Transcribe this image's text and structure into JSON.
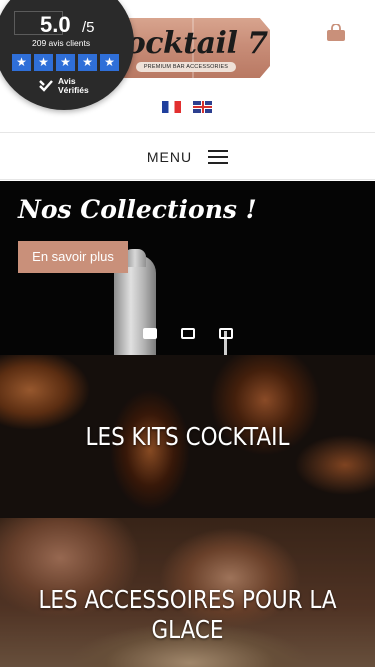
{
  "rating": {
    "score": "5.0",
    "max": "/5",
    "count": "209 avis clients",
    "stars": [
      "★",
      "★",
      "★",
      "★",
      "★"
    ],
    "brand_line1": "Avis",
    "brand_line2": "Vérifiés"
  },
  "header": {
    "logo_text": "Cocktail 7",
    "logo_sub": "PREMIUM BAR ACCESSORIES",
    "cart_icon": "shopping-bag-icon",
    "cart_color": "#c9907a",
    "languages": [
      "fr",
      "en"
    ]
  },
  "menu": {
    "label": "MENU"
  },
  "hero": {
    "title": "Nos Collections !",
    "button_label": "En savoir plus",
    "button_color": "#c9907a",
    "slides": 3,
    "active_slide": 1
  },
  "categories": [
    {
      "title": "LES KITS COCKTAIL"
    },
    {
      "title": "LES ACCESSOIRES POUR LA GLACE"
    }
  ]
}
